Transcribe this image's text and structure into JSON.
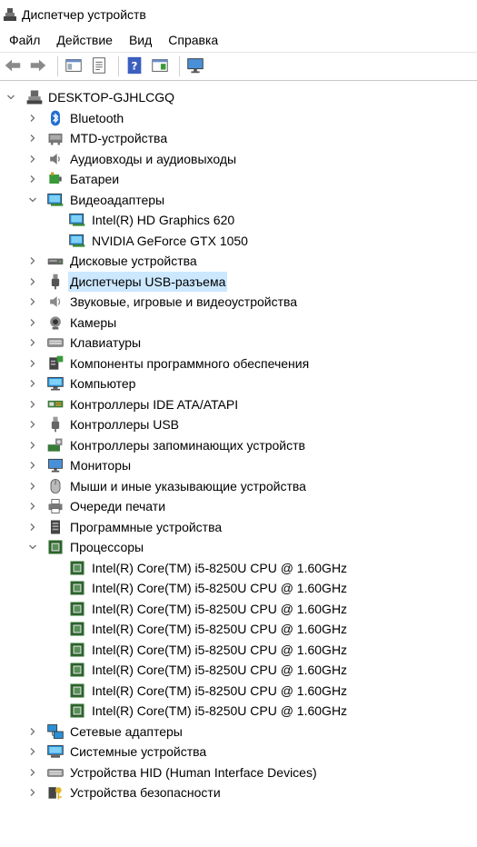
{
  "window": {
    "title": "Диспетчер устройств",
    "app_icon": "device-manager-icon"
  },
  "menu": [
    {
      "label": "Файл"
    },
    {
      "label": "Действие"
    },
    {
      "label": "Вид"
    },
    {
      "label": "Справка"
    }
  ],
  "toolbar": [
    {
      "name": "back-button",
      "icon": "back-arrow-icon"
    },
    {
      "name": "forward-button",
      "icon": "forward-arrow-icon"
    },
    {
      "name": "sep"
    },
    {
      "name": "show-hide-console-tree-button",
      "icon": "console-tree-icon"
    },
    {
      "name": "properties-button",
      "icon": "properties-icon"
    },
    {
      "name": "sep"
    },
    {
      "name": "help-button",
      "icon": "help-icon"
    },
    {
      "name": "action-pane-button",
      "icon": "action-pane-icon"
    },
    {
      "name": "sep"
    },
    {
      "name": "monitor-button",
      "icon": "monitor-icon"
    }
  ],
  "tree": {
    "root": {
      "label": "DESKTOP-GJHLCGQ",
      "expanded": true,
      "icon": "computer-icon"
    },
    "categories": [
      {
        "label": "Bluetooth",
        "icon": "bluetooth-icon",
        "expanded": false,
        "children": []
      },
      {
        "label": "MTD-устройства",
        "icon": "mtd-device-icon",
        "expanded": false,
        "children": []
      },
      {
        "label": "Аудиовходы и аудиовыходы",
        "icon": "speaker-icon",
        "expanded": false,
        "children": []
      },
      {
        "label": "Батареи",
        "icon": "battery-icon",
        "expanded": false,
        "children": []
      },
      {
        "label": "Видеоадаптеры",
        "icon": "display-adapter-icon",
        "expanded": true,
        "children": [
          {
            "label": "Intel(R) HD Graphics 620",
            "icon": "display-adapter-icon"
          },
          {
            "label": "NVIDIA GeForce GTX 1050",
            "icon": "display-adapter-icon"
          }
        ]
      },
      {
        "label": "Дисковые устройства",
        "icon": "disk-drive-icon",
        "expanded": false,
        "children": []
      },
      {
        "label": "Диспетчеры USB-разъема",
        "icon": "usb-connector-icon",
        "expanded": false,
        "selected": true,
        "children": []
      },
      {
        "label": "Звуковые, игровые и видеоустройства",
        "icon": "sound-icon",
        "expanded": false,
        "children": []
      },
      {
        "label": "Камеры",
        "icon": "camera-icon",
        "expanded": false,
        "children": []
      },
      {
        "label": "Клавиатуры",
        "icon": "keyboard-icon",
        "expanded": false,
        "children": []
      },
      {
        "label": "Компоненты программного обеспечения",
        "icon": "software-component-icon",
        "expanded": false,
        "children": []
      },
      {
        "label": "Компьютер",
        "icon": "computer-monitor-icon",
        "expanded": false,
        "children": []
      },
      {
        "label": "Контроллеры IDE ATA/ATAPI",
        "icon": "ide-controller-icon",
        "expanded": false,
        "children": []
      },
      {
        "label": "Контроллеры USB",
        "icon": "usb-icon",
        "expanded": false,
        "children": []
      },
      {
        "label": "Контроллеры запоминающих устройств",
        "icon": "storage-controller-icon",
        "expanded": false,
        "children": []
      },
      {
        "label": "Мониторы",
        "icon": "monitor-icon",
        "expanded": false,
        "children": []
      },
      {
        "label": "Мыши и иные указывающие устройства",
        "icon": "mouse-icon",
        "expanded": false,
        "children": []
      },
      {
        "label": "Очереди печати",
        "icon": "printer-icon",
        "expanded": false,
        "children": []
      },
      {
        "label": "Программные устройства",
        "icon": "software-device-icon",
        "expanded": false,
        "children": []
      },
      {
        "label": "Процессоры",
        "icon": "processor-icon",
        "expanded": true,
        "children": [
          {
            "label": "Intel(R) Core(TM) i5-8250U CPU @ 1.60GHz",
            "icon": "processor-icon"
          },
          {
            "label": "Intel(R) Core(TM) i5-8250U CPU @ 1.60GHz",
            "icon": "processor-icon"
          },
          {
            "label": "Intel(R) Core(TM) i5-8250U CPU @ 1.60GHz",
            "icon": "processor-icon"
          },
          {
            "label": "Intel(R) Core(TM) i5-8250U CPU @ 1.60GHz",
            "icon": "processor-icon"
          },
          {
            "label": "Intel(R) Core(TM) i5-8250U CPU @ 1.60GHz",
            "icon": "processor-icon"
          },
          {
            "label": "Intel(R) Core(TM) i5-8250U CPU @ 1.60GHz",
            "icon": "processor-icon"
          },
          {
            "label": "Intel(R) Core(TM) i5-8250U CPU @ 1.60GHz",
            "icon": "processor-icon"
          },
          {
            "label": "Intel(R) Core(TM) i5-8250U CPU @ 1.60GHz",
            "icon": "processor-icon"
          }
        ]
      },
      {
        "label": "Сетевые адаптеры",
        "icon": "network-adapter-icon",
        "expanded": false,
        "children": []
      },
      {
        "label": "Системные устройства",
        "icon": "system-device-icon",
        "expanded": false,
        "children": []
      },
      {
        "label": "Устройства HID (Human Interface Devices)",
        "icon": "hid-icon",
        "expanded": false,
        "children": []
      },
      {
        "label": "Устройства безопасности",
        "icon": "security-device-icon",
        "expanded": false,
        "children": []
      }
    ]
  },
  "colors": {
    "selection": "#cce8ff",
    "chevron": "#707070"
  }
}
